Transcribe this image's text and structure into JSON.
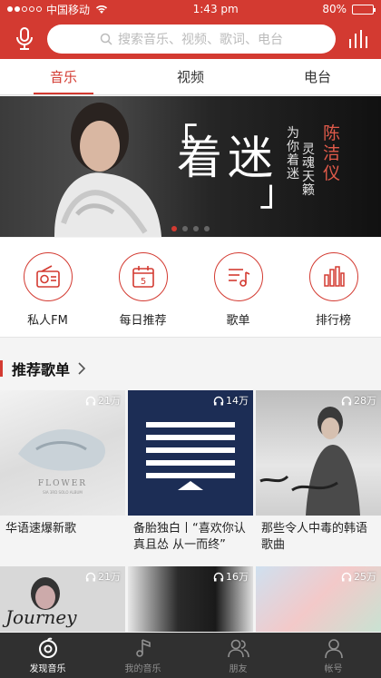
{
  "status": {
    "carrier": "中国移动",
    "time": "1:43 pm",
    "battery": "80%",
    "battery_level": 0.8
  },
  "header": {
    "search_placeholder": "搜索音乐、视频、歌词、电台"
  },
  "tabs": [
    {
      "label": "音乐",
      "active": true
    },
    {
      "label": "视频",
      "active": false
    },
    {
      "label": "电台",
      "active": false
    }
  ],
  "banner": {
    "title": "着迷",
    "subtitle_1": "为你着迷",
    "subtitle_2": "灵魂天籁",
    "artist": "陈洁仪",
    "page_count": 4,
    "active_index": 0
  },
  "quick_actions": [
    {
      "label": "私人FM",
      "icon": "radio-icon"
    },
    {
      "label": "每日推荐",
      "icon": "calendar-icon",
      "day": "5"
    },
    {
      "label": "歌单",
      "icon": "playlist-icon"
    },
    {
      "label": "排行榜",
      "icon": "chart-icon"
    }
  ],
  "section": {
    "title": "推荐歌单"
  },
  "playlists": [
    {
      "title": "华语速爆新歌",
      "count": "21万",
      "cover_text": "FLOWER",
      "cover_sub": "SIA 3RD SOLO ALBUM"
    },
    {
      "title": "备胎独白丨“喜欢你认真且怂 从一而终”",
      "count": "14万"
    },
    {
      "title": "那些令人中毒的韩语歌曲",
      "count": "28万"
    },
    {
      "title": "",
      "count": "21万",
      "cover_text": "Journey"
    },
    {
      "title": "",
      "count": "16万"
    },
    {
      "title": "",
      "count": "25万"
    }
  ],
  "bottom_nav": [
    {
      "label": "发现音乐",
      "icon": "discover-icon",
      "active": true
    },
    {
      "label": "我的音乐",
      "icon": "music-note-icon",
      "active": false
    },
    {
      "label": "朋友",
      "icon": "friends-icon",
      "active": false
    },
    {
      "label": "帐号",
      "icon": "account-icon",
      "active": false
    }
  ],
  "colors": {
    "brand": "#d33a31",
    "bottom_bar": "#2a2a2a"
  }
}
